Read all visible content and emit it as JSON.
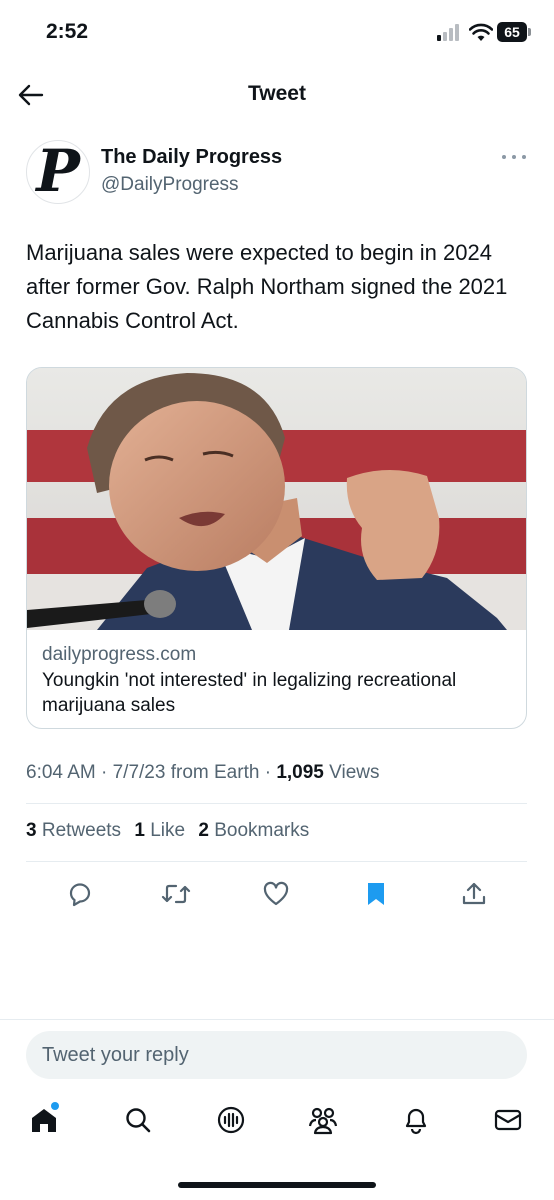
{
  "status_bar": {
    "time": "2:52",
    "battery": "65"
  },
  "header": {
    "title": "Tweet"
  },
  "tweet": {
    "author_name": "The Daily Progress",
    "author_handle": "@DailyProgress",
    "avatar_glyph": "P",
    "text": "Marijuana sales were expected to begin in 2024 after former Gov. Ralph Northam signed the 2021 Cannabis Control Act.",
    "card": {
      "domain": "dailyprogress.com",
      "title": "Youngkin 'not interested' in legalizing recreational marijuana sales"
    },
    "meta": {
      "time": "6:04 AM",
      "date": "7/7/23",
      "source": "from Earth",
      "views_count": "1,095",
      "views_label": "Views"
    },
    "stats": {
      "retweets_count": "3",
      "retweets_label": "Retweets",
      "likes_count": "1",
      "likes_label": "Like",
      "bookmarks_count": "2",
      "bookmarks_label": "Bookmarks"
    }
  },
  "actions": [
    "reply-icon",
    "retweet-icon",
    "like-icon",
    "bookmark-icon",
    "share-icon"
  ],
  "reply": {
    "placeholder": "Tweet your reply"
  },
  "tab_bar": [
    "home-icon",
    "search-icon",
    "spaces-icon",
    "communities-icon",
    "notifications-icon",
    "messages-icon"
  ],
  "colors": {
    "accent": "#1d9bf0",
    "text": "#0f1419",
    "secondary": "#536471",
    "border": "#cfd9de"
  }
}
